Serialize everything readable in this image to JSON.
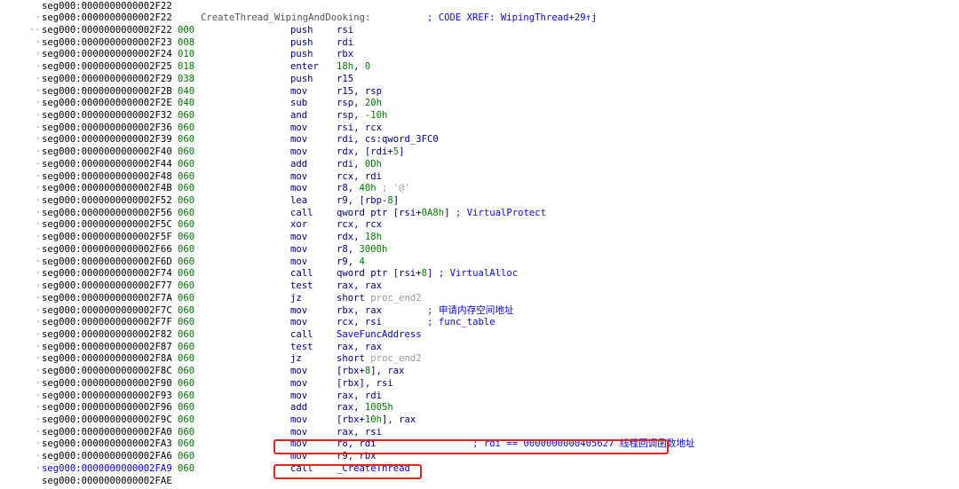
{
  "app": "IDA disassembly listing",
  "label": {
    "name": "CreateThread_WipingAndDooking:",
    "xref": "; CODE XREF: WipingThread+29↑j"
  },
  "lines": [
    {
      "addr": "seg000:0000000000002F22",
      "kind": "blank"
    },
    {
      "addr": "seg000:0000000000002F22",
      "kind": "label"
    },
    {
      "addr": "seg000:0000000000002F22",
      "sp": "000",
      "mnem": "push",
      "ops": [
        {
          "t": "rsi"
        }
      ]
    },
    {
      "addr": "seg000:0000000000002F23",
      "sp": "008",
      "mnem": "push",
      "ops": [
        {
          "t": "rdi"
        }
      ]
    },
    {
      "addr": "seg000:0000000000002F24",
      "sp": "010",
      "mnem": "push",
      "ops": [
        {
          "t": "rbx"
        }
      ]
    },
    {
      "addr": "seg000:0000000000002F25",
      "sp": "018",
      "mnem": "enter",
      "ops": [
        {
          "t": "18h",
          "c": "num"
        },
        {
          "t": ", "
        },
        {
          "t": "0",
          "c": "num"
        }
      ]
    },
    {
      "addr": "seg000:0000000000002F29",
      "sp": "038",
      "mnem": "push",
      "ops": [
        {
          "t": "r15"
        }
      ]
    },
    {
      "addr": "seg000:0000000000002F2B",
      "sp": "040",
      "mnem": "mov",
      "ops": [
        {
          "t": "r15, rsp"
        }
      ]
    },
    {
      "addr": "seg000:0000000000002F2E",
      "sp": "040",
      "mnem": "sub",
      "ops": [
        {
          "t": "rsp, "
        },
        {
          "t": "20h",
          "c": "num"
        }
      ]
    },
    {
      "addr": "seg000:0000000000002F32",
      "sp": "060",
      "mnem": "and",
      "ops": [
        {
          "t": "rsp, "
        },
        {
          "t": "-10h",
          "c": "num"
        }
      ]
    },
    {
      "addr": "seg000:0000000000002F36",
      "sp": "060",
      "mnem": "mov",
      "ops": [
        {
          "t": "rsi, rcx"
        }
      ]
    },
    {
      "addr": "seg000:0000000000002F39",
      "sp": "060",
      "mnem": "mov",
      "ops": [
        {
          "t": "rdi, cs:qword_3FC0"
        }
      ]
    },
    {
      "addr": "seg000:0000000000002F40",
      "sp": "060",
      "mnem": "mov",
      "ops": [
        {
          "t": "rdx, [rdi+"
        },
        {
          "t": "5",
          "c": "num"
        },
        {
          "t": "]"
        }
      ]
    },
    {
      "addr": "seg000:0000000000002F44",
      "sp": "060",
      "mnem": "add",
      "ops": [
        {
          "t": "rdi, "
        },
        {
          "t": "0Dh",
          "c": "num"
        }
      ]
    },
    {
      "addr": "seg000:0000000000002F48",
      "sp": "060",
      "mnem": "mov",
      "ops": [
        {
          "t": "rcx, rdi"
        }
      ]
    },
    {
      "addr": "seg000:0000000000002F4B",
      "sp": "060",
      "mnem": "mov",
      "ops": [
        {
          "t": "r8, "
        },
        {
          "t": "40h",
          "c": "num"
        },
        {
          "t": " ; '@'",
          "c": "sym"
        }
      ]
    },
    {
      "addr": "seg000:0000000000002F52",
      "sp": "060",
      "mnem": "lea",
      "ops": [
        {
          "t": "r9, [rbp-"
        },
        {
          "t": "8",
          "c": "num"
        },
        {
          "t": "]"
        }
      ]
    },
    {
      "addr": "seg000:0000000000002F56",
      "sp": "060",
      "mnem": "call",
      "ops": [
        {
          "t": "qword ptr [rsi+"
        },
        {
          "t": "0A8h",
          "c": "num"
        },
        {
          "t": "] "
        },
        {
          "t": "; VirtualProtect",
          "c": "cm"
        }
      ]
    },
    {
      "addr": "seg000:0000000000002F5C",
      "sp": "060",
      "mnem": "xor",
      "ops": [
        {
          "t": "rcx, rcx"
        }
      ]
    },
    {
      "addr": "seg000:0000000000002F5F",
      "sp": "060",
      "mnem": "mov",
      "ops": [
        {
          "t": "rdx, "
        },
        {
          "t": "18h",
          "c": "num"
        }
      ]
    },
    {
      "addr": "seg000:0000000000002F66",
      "sp": "060",
      "mnem": "mov",
      "ops": [
        {
          "t": "r8, "
        },
        {
          "t": "3000h",
          "c": "num"
        }
      ]
    },
    {
      "addr": "seg000:0000000000002F6D",
      "sp": "060",
      "mnem": "mov",
      "ops": [
        {
          "t": "r9, "
        },
        {
          "t": "4",
          "c": "num"
        }
      ]
    },
    {
      "addr": "seg000:0000000000002F74",
      "sp": "060",
      "mnem": "call",
      "ops": [
        {
          "t": "qword ptr [rsi+"
        },
        {
          "t": "8",
          "c": "num"
        },
        {
          "t": "] "
        },
        {
          "t": "; VirtualAlloc",
          "c": "cm"
        }
      ]
    },
    {
      "addr": "seg000:0000000000002F77",
      "sp": "060",
      "mnem": "test",
      "ops": [
        {
          "t": "rax, rax"
        }
      ]
    },
    {
      "addr": "seg000:0000000000002F7A",
      "sp": "060",
      "mnem": "jz",
      "ops": [
        {
          "t": "short "
        },
        {
          "t": "proc_end2",
          "c": "sym"
        }
      ]
    },
    {
      "addr": "seg000:0000000000002F7C",
      "sp": "060",
      "mnem": "mov",
      "ops": [
        {
          "t": "rbx, rax        "
        },
        {
          "t": "; 申请内存空间地址",
          "c": "cm"
        }
      ]
    },
    {
      "addr": "seg000:0000000000002F7F",
      "sp": "060",
      "mnem": "mov",
      "ops": [
        {
          "t": "rcx, rsi        "
        },
        {
          "t": "; func_table",
          "c": "cm"
        }
      ]
    },
    {
      "addr": "seg000:0000000000002F82",
      "sp": "060",
      "mnem": "call",
      "ops": [
        {
          "t": "SaveFuncAddress",
          "c": "fn"
        }
      ]
    },
    {
      "addr": "seg000:0000000000002F87",
      "sp": "060",
      "mnem": "test",
      "ops": [
        {
          "t": "rax, rax"
        }
      ]
    },
    {
      "addr": "seg000:0000000000002F8A",
      "sp": "060",
      "mnem": "jz",
      "ops": [
        {
          "t": "short "
        },
        {
          "t": "proc_end2",
          "c": "sym"
        }
      ]
    },
    {
      "addr": "seg000:0000000000002F8C",
      "sp": "060",
      "mnem": "mov",
      "ops": [
        {
          "t": "[rbx+"
        },
        {
          "t": "8",
          "c": "num"
        },
        {
          "t": "], rax"
        }
      ]
    },
    {
      "addr": "seg000:0000000000002F90",
      "sp": "060",
      "mnem": "mov",
      "ops": [
        {
          "t": "[rbx], rsi"
        }
      ]
    },
    {
      "addr": "seg000:0000000000002F93",
      "sp": "060",
      "mnem": "mov",
      "ops": [
        {
          "t": "rax, rdi"
        }
      ]
    },
    {
      "addr": "seg000:0000000000002F96",
      "sp": "060",
      "mnem": "add",
      "ops": [
        {
          "t": "rax, "
        },
        {
          "t": "1005h",
          "c": "num"
        }
      ]
    },
    {
      "addr": "seg000:0000000000002F9C",
      "sp": "060",
      "mnem": "mov",
      "ops": [
        {
          "t": "[rbx+"
        },
        {
          "t": "10h",
          "c": "num"
        },
        {
          "t": "], rax"
        }
      ]
    },
    {
      "addr": "seg000:0000000000002FA0",
      "sp": "060",
      "mnem": "mov",
      "ops": [
        {
          "t": "rax, rsi"
        }
      ]
    },
    {
      "addr": "seg000:0000000000002FA3",
      "sp": "060",
      "mnem": "mov",
      "ops": [
        {
          "t": "r8, rdi                 "
        },
        {
          "t": "; rdi == 0000000000405627 线程回调函数地址",
          "c": "cm"
        }
      ]
    },
    {
      "addr": "seg000:0000000000002FA6",
      "sp": "060",
      "mnem": "mov",
      "ops": [
        {
          "t": "r9, rbx"
        }
      ]
    },
    {
      "addr": "seg000:0000000000002FA9",
      "sp": "060",
      "mnem": "call",
      "ops": [
        {
          "t": "_CreateThread",
          "c": "fn"
        }
      ],
      "current": true
    },
    {
      "addr": "seg000:0000000000002FAE",
      "kind": "blank"
    }
  ],
  "colors": {
    "highlight": "#e0251b",
    "comment": "#0a0af0",
    "number": "#008000",
    "stack": "#007a00",
    "mnemonic": "#000080"
  }
}
